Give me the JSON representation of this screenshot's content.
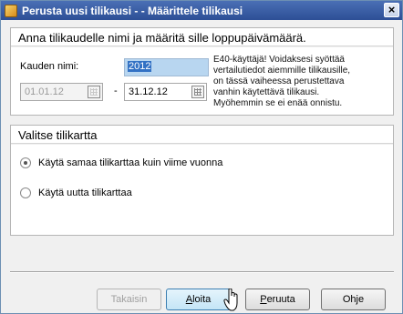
{
  "window": {
    "title": "Perusta uusi tilikausi - - Määrittele tilikausi",
    "close": "×"
  },
  "period_group": {
    "title": "Anna tilikaudelle nimi ja määritä sille loppupäivämäärä.",
    "name_label": "Kauden nimi:",
    "name_value": "2012",
    "start_date": "01.01.12",
    "date_dash": "-",
    "end_date": "31.12.12",
    "info_lines": [
      "E40-käyttäjä! Voidaksesi syöttää",
      "vertailutiedot  aiemmille tilikausille,",
      "on tässä vaiheessa perustettava",
      "vanhin käytettävä tilikausi.",
      "Myöhemmin se ei enää onnistu."
    ]
  },
  "chart_group": {
    "title": "Valitse tilikartta",
    "options": [
      {
        "label": "Käytä samaa tilikarttaa kuin viime vuonna",
        "checked": true
      },
      {
        "label": "Käytä uutta tilikarttaa",
        "checked": false
      }
    ]
  },
  "buttons": {
    "back": "Takaisin",
    "start_first": "A",
    "start_rest": "loita",
    "cancel_first": "P",
    "cancel_rest": "eruuta",
    "help": "Ohje"
  }
}
